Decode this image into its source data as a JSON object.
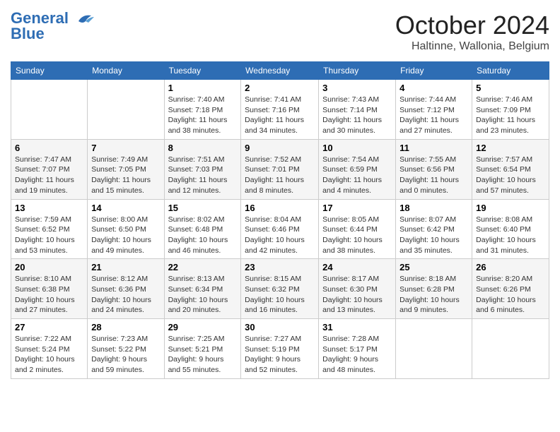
{
  "header": {
    "logo_line1": "General",
    "logo_line2": "Blue",
    "month_title": "October 2024",
    "subtitle": "Haltinne, Wallonia, Belgium"
  },
  "weekdays": [
    "Sunday",
    "Monday",
    "Tuesday",
    "Wednesday",
    "Thursday",
    "Friday",
    "Saturday"
  ],
  "weeks": [
    [
      {
        "day": "",
        "info": ""
      },
      {
        "day": "",
        "info": ""
      },
      {
        "day": "1",
        "info": "Sunrise: 7:40 AM\nSunset: 7:18 PM\nDaylight: 11 hours and 38 minutes."
      },
      {
        "day": "2",
        "info": "Sunrise: 7:41 AM\nSunset: 7:16 PM\nDaylight: 11 hours and 34 minutes."
      },
      {
        "day": "3",
        "info": "Sunrise: 7:43 AM\nSunset: 7:14 PM\nDaylight: 11 hours and 30 minutes."
      },
      {
        "day": "4",
        "info": "Sunrise: 7:44 AM\nSunset: 7:12 PM\nDaylight: 11 hours and 27 minutes."
      },
      {
        "day": "5",
        "info": "Sunrise: 7:46 AM\nSunset: 7:09 PM\nDaylight: 11 hours and 23 minutes."
      }
    ],
    [
      {
        "day": "6",
        "info": "Sunrise: 7:47 AM\nSunset: 7:07 PM\nDaylight: 11 hours and 19 minutes."
      },
      {
        "day": "7",
        "info": "Sunrise: 7:49 AM\nSunset: 7:05 PM\nDaylight: 11 hours and 15 minutes."
      },
      {
        "day": "8",
        "info": "Sunrise: 7:51 AM\nSunset: 7:03 PM\nDaylight: 11 hours and 12 minutes."
      },
      {
        "day": "9",
        "info": "Sunrise: 7:52 AM\nSunset: 7:01 PM\nDaylight: 11 hours and 8 minutes."
      },
      {
        "day": "10",
        "info": "Sunrise: 7:54 AM\nSunset: 6:59 PM\nDaylight: 11 hours and 4 minutes."
      },
      {
        "day": "11",
        "info": "Sunrise: 7:55 AM\nSunset: 6:56 PM\nDaylight: 11 hours and 0 minutes."
      },
      {
        "day": "12",
        "info": "Sunrise: 7:57 AM\nSunset: 6:54 PM\nDaylight: 10 hours and 57 minutes."
      }
    ],
    [
      {
        "day": "13",
        "info": "Sunrise: 7:59 AM\nSunset: 6:52 PM\nDaylight: 10 hours and 53 minutes."
      },
      {
        "day": "14",
        "info": "Sunrise: 8:00 AM\nSunset: 6:50 PM\nDaylight: 10 hours and 49 minutes."
      },
      {
        "day": "15",
        "info": "Sunrise: 8:02 AM\nSunset: 6:48 PM\nDaylight: 10 hours and 46 minutes."
      },
      {
        "day": "16",
        "info": "Sunrise: 8:04 AM\nSunset: 6:46 PM\nDaylight: 10 hours and 42 minutes."
      },
      {
        "day": "17",
        "info": "Sunrise: 8:05 AM\nSunset: 6:44 PM\nDaylight: 10 hours and 38 minutes."
      },
      {
        "day": "18",
        "info": "Sunrise: 8:07 AM\nSunset: 6:42 PM\nDaylight: 10 hours and 35 minutes."
      },
      {
        "day": "19",
        "info": "Sunrise: 8:08 AM\nSunset: 6:40 PM\nDaylight: 10 hours and 31 minutes."
      }
    ],
    [
      {
        "day": "20",
        "info": "Sunrise: 8:10 AM\nSunset: 6:38 PM\nDaylight: 10 hours and 27 minutes."
      },
      {
        "day": "21",
        "info": "Sunrise: 8:12 AM\nSunset: 6:36 PM\nDaylight: 10 hours and 24 minutes."
      },
      {
        "day": "22",
        "info": "Sunrise: 8:13 AM\nSunset: 6:34 PM\nDaylight: 10 hours and 20 minutes."
      },
      {
        "day": "23",
        "info": "Sunrise: 8:15 AM\nSunset: 6:32 PM\nDaylight: 10 hours and 16 minutes."
      },
      {
        "day": "24",
        "info": "Sunrise: 8:17 AM\nSunset: 6:30 PM\nDaylight: 10 hours and 13 minutes."
      },
      {
        "day": "25",
        "info": "Sunrise: 8:18 AM\nSunset: 6:28 PM\nDaylight: 10 hours and 9 minutes."
      },
      {
        "day": "26",
        "info": "Sunrise: 8:20 AM\nSunset: 6:26 PM\nDaylight: 10 hours and 6 minutes."
      }
    ],
    [
      {
        "day": "27",
        "info": "Sunrise: 7:22 AM\nSunset: 5:24 PM\nDaylight: 10 hours and 2 minutes."
      },
      {
        "day": "28",
        "info": "Sunrise: 7:23 AM\nSunset: 5:22 PM\nDaylight: 9 hours and 59 minutes."
      },
      {
        "day": "29",
        "info": "Sunrise: 7:25 AM\nSunset: 5:21 PM\nDaylight: 9 hours and 55 minutes."
      },
      {
        "day": "30",
        "info": "Sunrise: 7:27 AM\nSunset: 5:19 PM\nDaylight: 9 hours and 52 minutes."
      },
      {
        "day": "31",
        "info": "Sunrise: 7:28 AM\nSunset: 5:17 PM\nDaylight: 9 hours and 48 minutes."
      },
      {
        "day": "",
        "info": ""
      },
      {
        "day": "",
        "info": ""
      }
    ]
  ]
}
